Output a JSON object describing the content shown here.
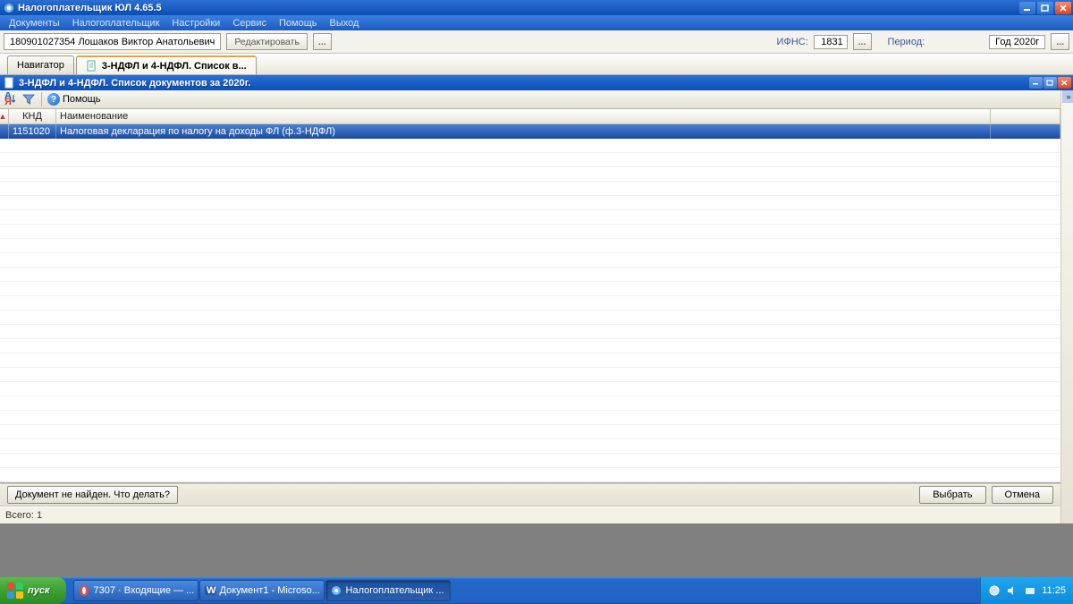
{
  "app": {
    "title": "Налогоплательщик ЮЛ 4.65.5"
  },
  "menu": {
    "items": [
      "Документы",
      "Налогоплательщик",
      "Настройки",
      "Сервис",
      "Помощь",
      "Выход"
    ]
  },
  "infobar": {
    "taxpayer": "180901027354 Лошаков Виктор Анатольевич",
    "edit_btn": "Редактировать",
    "dots": "...",
    "ifns_label": "ИФНС:",
    "ifns_value": "1831",
    "period_label": "Период:",
    "year_value": "Год 2020г"
  },
  "tabs": {
    "navigator": "Навигатор",
    "doclist": "3-НДФЛ и 4-НДФЛ. Список в..."
  },
  "subwin": {
    "title": "3-НДФЛ и 4-НДФЛ. Список документов за 2020г."
  },
  "toolbar": {
    "help": "Помощь"
  },
  "table": {
    "headers": {
      "knd": "КНД",
      "name": "Наименование"
    },
    "row": {
      "knd": "1151020",
      "name": "Налоговая декларация по налогу на доходы ФЛ (ф.3-НДФЛ)"
    }
  },
  "buttons": {
    "not_found": "Документ не найден. Что делать?",
    "select": "Выбрать",
    "cancel": "Отмена"
  },
  "status": {
    "total": "Всего: 1"
  },
  "taskbar": {
    "start": "пуск",
    "items": [
      "7307 · Входящие — ...",
      "Документ1 - Microso...",
      "Налогоплательщик ..."
    ],
    "clock": "11:25"
  }
}
